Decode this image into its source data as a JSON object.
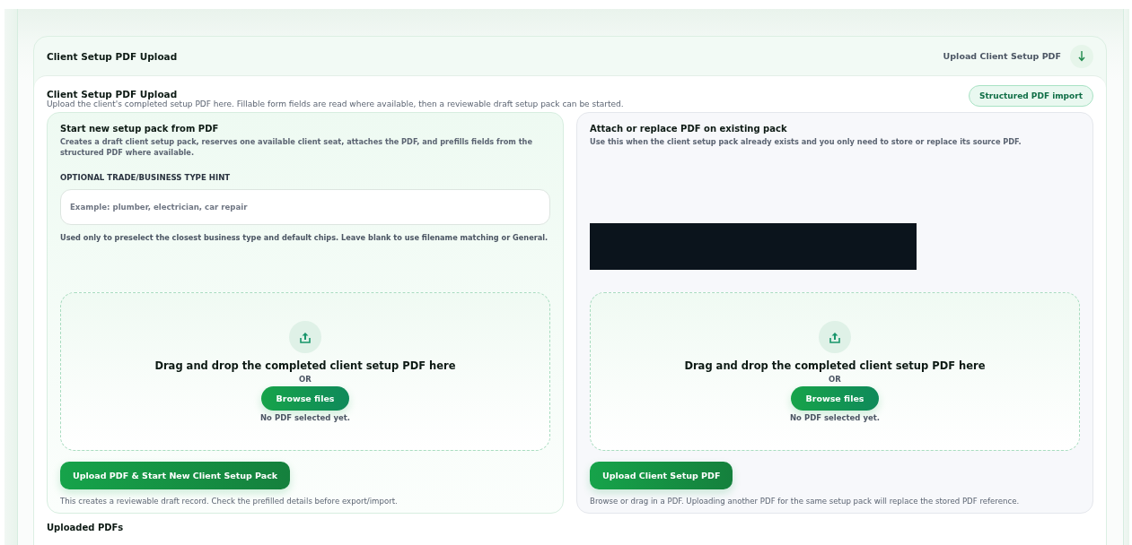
{
  "section": {
    "title": "Client Setup PDF Upload",
    "action_label": "Upload Client Setup PDF",
    "expanded": true
  },
  "intro": {
    "title": "Client Setup PDF Upload",
    "description": "Upload the client's completed setup PDF here. Fillable form fields are read where available, then a reviewable draft setup pack can be started.",
    "badge": "Structured PDF import"
  },
  "panels": [
    {
      "kind": "new",
      "title": "Start new setup pack from PDF",
      "description": "Creates a draft client setup pack, reserves one available client seat, attaches the PDF, and prefills fields from the structured PDF where available.",
      "field_label": "OPTIONAL TRADE/BUSINESS TYPE HINT",
      "placeholder": "Example: plumber, electrician, car repair",
      "field_help": "Used only to preselect the closest business type and default chips. Leave blank to use filename matching or General.",
      "drop_text": "Drag and drop the completed client setup PDF here",
      "or_text": "OR",
      "browse_label": "Browse files",
      "file_status": "No PDF selected yet.",
      "submit_label": "Upload PDF & Start New Client Setup Pack",
      "note": "This creates a reviewable draft record. Check the prefilled details before export/import."
    },
    {
      "kind": "attach",
      "title": "Attach or replace PDF on existing pack",
      "description": "Use this when the client setup pack already exists and you only need to store or replace its source PDF.",
      "redacted": true,
      "drop_text": "Drag and drop the completed client setup PDF here",
      "or_text": "OR",
      "browse_label": "Browse files",
      "file_status": "No PDF selected yet.",
      "submit_label": "Upload Client Setup PDF",
      "note": "Browse or drag in a PDF. Uploading another PDF for the same setup pack will replace the stored PDF reference."
    }
  ],
  "uploaded_heading": "Uploaded PDFs"
}
